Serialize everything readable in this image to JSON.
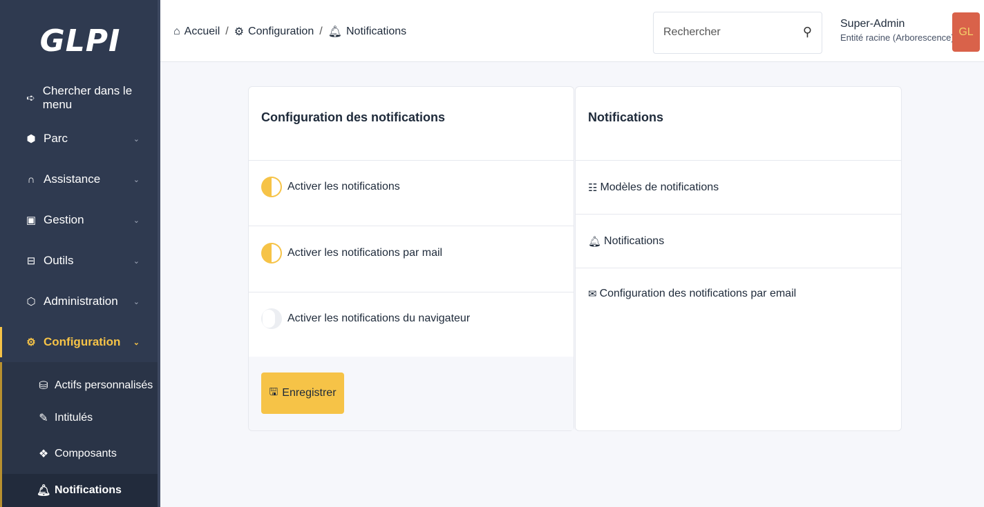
{
  "app": {
    "logo": "GLPI"
  },
  "sidebar": {
    "search_label": "Chercher dans le menu",
    "items": [
      {
        "label": "Parc",
        "icon": "box-icon"
      },
      {
        "label": "Assistance",
        "icon": "headset-icon"
      },
      {
        "label": "Gestion",
        "icon": "wallet-icon"
      },
      {
        "label": "Outils",
        "icon": "briefcase-icon"
      },
      {
        "label": "Administration",
        "icon": "shield-icon"
      },
      {
        "label": "Configuration",
        "icon": "gear-icon"
      }
    ],
    "submenu": [
      {
        "label": "Actifs personnalisés",
        "icon": "database-icon"
      },
      {
        "label": "Intitulés",
        "icon": "pencil-icon"
      },
      {
        "label": "Composants",
        "icon": "components-icon"
      },
      {
        "label": "Notifications",
        "icon": "bell-icon"
      }
    ]
  },
  "header": {
    "breadcrumb": [
      "Accueil",
      "Configuration",
      "Notifications"
    ],
    "search_placeholder": "Rechercher",
    "user_name": "Super-Admin",
    "user_entity": "Entité racine (Arborescence)",
    "avatar_initials": "GL"
  },
  "config_card": {
    "title": "Configuration des notifications",
    "toggles": [
      {
        "label": "Activer les notifications",
        "enabled": true
      },
      {
        "label": "Activer les notifications par mail",
        "enabled": true
      },
      {
        "label": "Activer les notifications du navigateur",
        "enabled": false
      }
    ],
    "save_label": "Enregistrer"
  },
  "notifications_card": {
    "title": "Notifications",
    "links": [
      {
        "label": "Modèles de notifications",
        "icon": "template-icon"
      },
      {
        "label": "Notifications",
        "icon": "bell-icon"
      },
      {
        "label": "Configuration des notifications par email",
        "icon": "mail-icon"
      }
    ]
  },
  "colors": {
    "sidebar_bg": "#2f3a50",
    "accent": "#f6c347",
    "avatar_bg": "#d9624a"
  }
}
